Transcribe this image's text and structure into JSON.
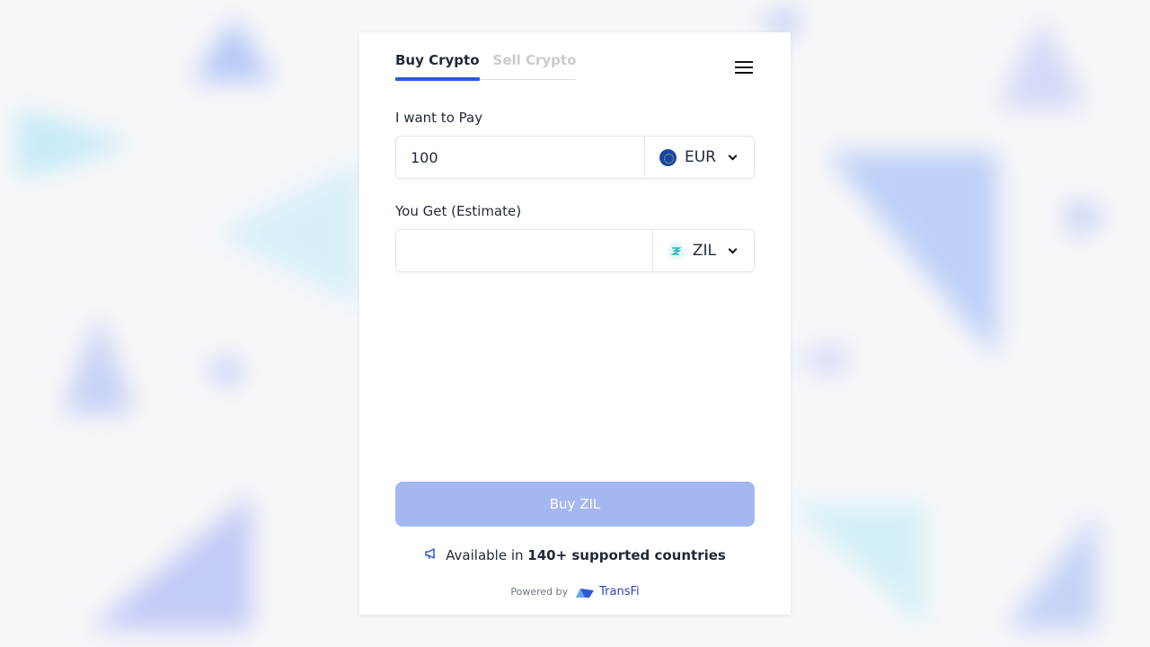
{
  "tabs": {
    "buy_label": "Buy Crypto",
    "sell_label": "Sell Crypto"
  },
  "pay": {
    "label": "I want to Pay",
    "amount": "100",
    "currency": "EUR",
    "currency_icon": "eu-flag-icon"
  },
  "get": {
    "label": "You Get (Estimate)",
    "amount": "",
    "currency": "ZIL",
    "currency_icon": "zilliqa-icon"
  },
  "buy_button_label": "Buy ZIL",
  "availability": {
    "prefix": "Available in",
    "highlight": "140+ supported countries"
  },
  "footer": {
    "powered_by": "Powered by",
    "brand": "TransFi"
  },
  "colors": {
    "accent": "#2b59d9",
    "button_disabled": "#a4b7f0",
    "brand": "#2b3fbf"
  }
}
